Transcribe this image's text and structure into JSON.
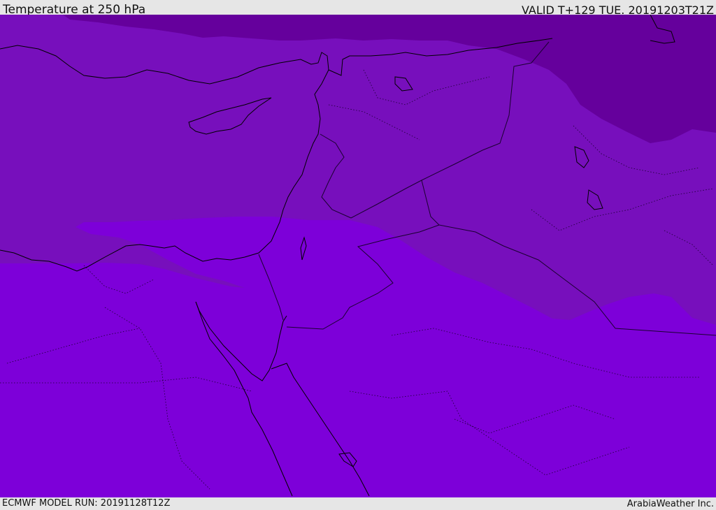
{
  "header": {
    "title": "Temperature at 250 hPa",
    "valid": "VALID T+129 TUE. 20191203T21Z"
  },
  "footer": {
    "model_run": "ECMWF MODEL RUN: 20191128T12Z",
    "credit": "ArabiaWeather Inc."
  },
  "map": {
    "region": "Eastern Mediterranean / Middle East",
    "field": "temperature-250hPa",
    "colors": {
      "warm_band": "#7d00d9",
      "mid_band": "#770fbc",
      "cold_band": "#65009c",
      "coastline": "#000000",
      "border": "#1a0030"
    }
  }
}
